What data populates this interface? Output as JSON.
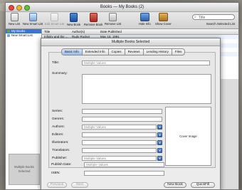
{
  "window": {
    "title": "Books — My Books (2)"
  },
  "toolbar": {
    "buttons": [
      {
        "label": "New List",
        "icon": "new-list-icon"
      },
      {
        "label": "New Smart List",
        "icon": "smart-list-icon"
      },
      {
        "label": "Edit Smart List",
        "icon": "edit-smart-list-icon"
      },
      {
        "label": "New Book",
        "icon": "new-book-icon"
      },
      {
        "label": "Remove Book",
        "icon": "remove-book-icon"
      },
      {
        "label": "Remove List",
        "icon": "remove-list-icon"
      },
      {
        "label": "Hide Info",
        "icon": "hide-info-icon"
      },
      {
        "label": "Show Cover",
        "icon": "show-cover-icon"
      }
    ],
    "search_placeholder": "Title",
    "search_label": "Search Selected List"
  },
  "sidebar": {
    "items": [
      {
        "label": "My Books"
      },
      {
        "label": "New Smart List"
      }
    ],
    "cover_placeholder": "Multiple Books Selected"
  },
  "table": {
    "columns": [
      "Title",
      "Author(s)",
      "Date Published"
    ],
    "rows": [
      {
        "title": "Infinity and the ...",
        "author": "Rudy Rucker",
        "date": "May 15, 1991"
      }
    ]
  },
  "sheet": {
    "title": "Multiple Books Selected",
    "tabs": [
      "Basic Info",
      "Extended Info",
      "Copies",
      "Reviews",
      "Lending History",
      "Files"
    ],
    "fields": {
      "title_label": "Title:",
      "title_value": "Multiple Values",
      "summary_label": "Summary:",
      "series_label": "Series:",
      "genres_label": "Genres:",
      "authors_label": "Authors:",
      "authors_value": "Multiple Values",
      "editors_label": "Editors:",
      "illustrators_label": "Illustrators:",
      "translators_label": "Translators:",
      "publisher_label": "Publisher:",
      "publisher_value": "Multiple Values",
      "publish_date_label": "Publish Date:",
      "publish_date_value": "Multiple Values",
      "isbn_label": "ISBN:"
    },
    "cover_label": "Cover Image",
    "buttons": {
      "previous": "Previous",
      "next": "Next",
      "new_book": "New Book",
      "quickfill": "QuickFill"
    }
  }
}
